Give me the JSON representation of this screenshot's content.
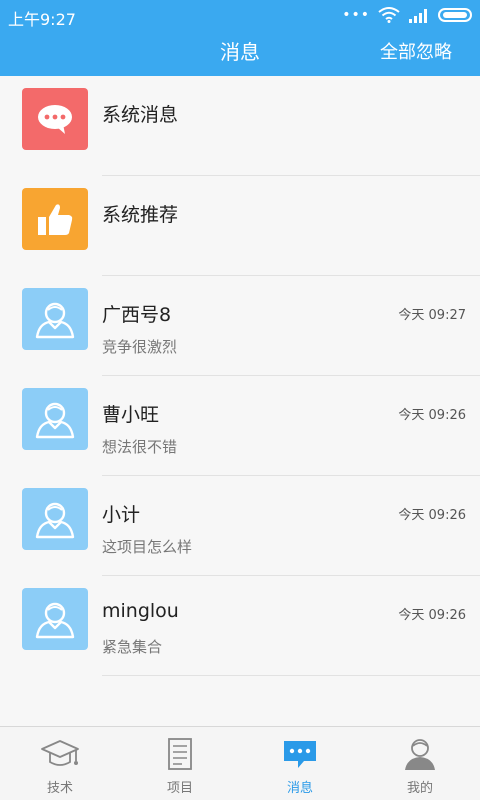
{
  "status": {
    "time": "上午9:27"
  },
  "header": {
    "title": "消息",
    "action": "全部忽略"
  },
  "messages": [
    {
      "title": "系统消息",
      "subtitle": "",
      "time": "",
      "icon": "chat-bubble-icon",
      "color": "#f36a6a"
    },
    {
      "title": "系统推荐",
      "subtitle": "",
      "time": "",
      "icon": "thumbs-up-icon",
      "color": "#f8a531"
    },
    {
      "title": "广西号8",
      "subtitle": "竞争很激烈",
      "time": "今天 09:27",
      "icon": "user-avatar-icon",
      "color": "#8ccdf7"
    },
    {
      "title": "曹小旺",
      "subtitle": "想法很不错",
      "time": "今天 09:26",
      "icon": "user-avatar-icon",
      "color": "#8ccdf7"
    },
    {
      "title": "小计",
      "subtitle": "这项目怎么样",
      "time": "今天 09:26",
      "icon": "user-avatar-icon",
      "color": "#8ccdf7"
    },
    {
      "title": "minglou",
      "subtitle": "紧急集合",
      "time": "今天 09:26",
      "icon": "user-avatar-icon",
      "color": "#8ccdf7"
    }
  ],
  "tabs": [
    {
      "label": "技术",
      "icon": "graduation-cap-icon",
      "active": false
    },
    {
      "label": "项目",
      "icon": "document-icon",
      "active": false
    },
    {
      "label": "消息",
      "icon": "message-icon",
      "active": true
    },
    {
      "label": "我的",
      "icon": "profile-icon",
      "active": false
    }
  ],
  "colors": {
    "primary": "#3aa9f0",
    "active_tab": "#2a9ae8"
  }
}
